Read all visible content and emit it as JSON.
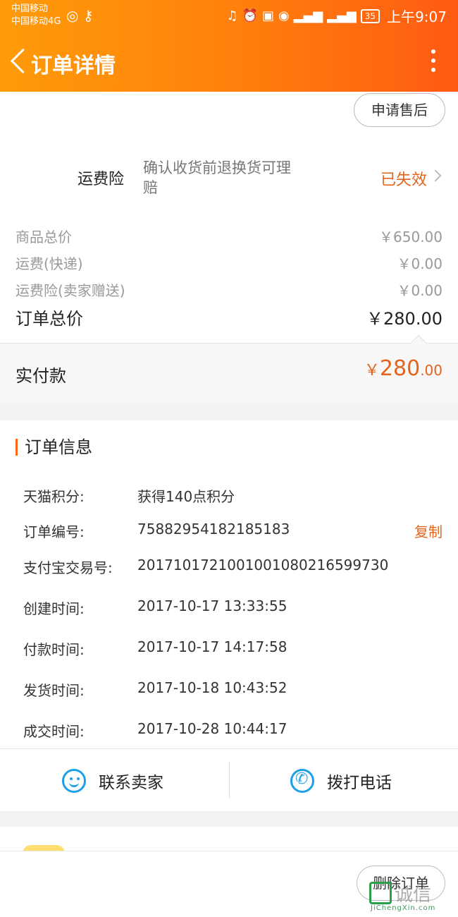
{
  "status_bar": {
    "carrier_1": "中国移动",
    "carrier_2": "中国移动4G",
    "battery": "35",
    "time": "上午9:07"
  },
  "header": {
    "title": "订单详情"
  },
  "after_sale_button": "申请售后",
  "shipping_insurance": {
    "label": "运费险",
    "description": "确认收货前退换货可理赔",
    "status": "已失效"
  },
  "price_summary": {
    "goods_total_label": "商品总价",
    "goods_total_value": "￥650.00",
    "shipping_label": "运费(快递)",
    "shipping_value": "￥0.00",
    "insurance_label": "运费险(卖家赠送)",
    "insurance_value": "￥0.00",
    "order_total_label": "订单总价",
    "order_total_value": "￥280.00"
  },
  "actual_paid": {
    "label": "实付款",
    "currency": "￥",
    "integer": "280",
    "decimal": ".00"
  },
  "order_info": {
    "title": "订单信息",
    "rows": [
      {
        "label": "天猫积分:",
        "value": "获得140点积分"
      },
      {
        "label": "订单编号:",
        "value": "75882954182185183"
      },
      {
        "label": "支付宝交易号:",
        "value": "2017101721001001080216599730"
      },
      {
        "label": "创建时间:",
        "value": "2017-10-17 13:33:55"
      },
      {
        "label": "付款时间:",
        "value": "2017-10-17 14:17:58"
      },
      {
        "label": "发货时间:",
        "value": "2017-10-18 10:43:52"
      },
      {
        "label": "成交时间:",
        "value": "2017-10-28 10:44:17"
      }
    ],
    "copy_label": "复制"
  },
  "contact": {
    "seller_label": "联系卖家",
    "call_label": "拨打电话"
  },
  "footer": {
    "delete_label": "删除订单"
  },
  "watermark": {
    "text": "诚信",
    "sub": "JiChengXin.com"
  },
  "colors": {
    "header_start": "#ff9b0a",
    "header_end": "#ff5a13",
    "accent": "#e2641b",
    "icon_blue": "#1ea0e8"
  }
}
